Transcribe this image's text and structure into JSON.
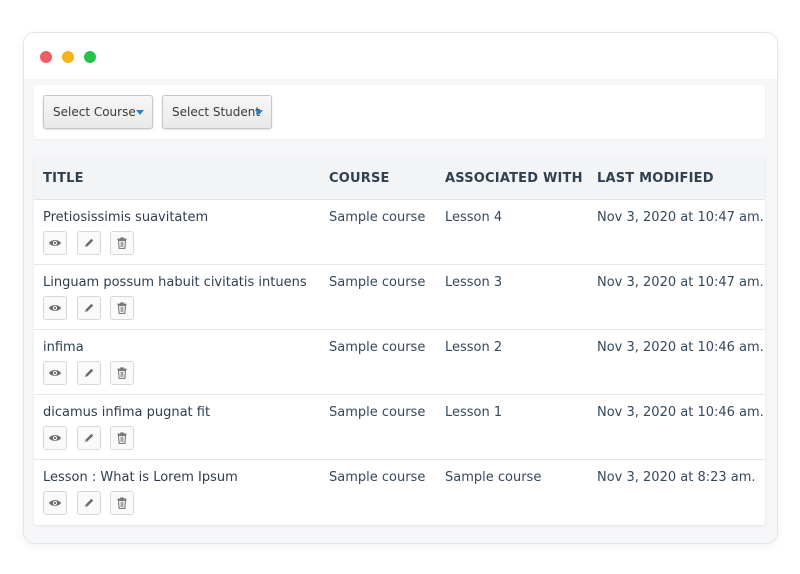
{
  "filters": {
    "course_label": "Select Course",
    "student_label": "Select Student"
  },
  "table": {
    "headers": [
      "TITLE",
      "COURSE",
      "ASSOCIATED WITH",
      "LAST MODIFIED"
    ],
    "rows": [
      {
        "title": "Pretiosissimis suavitatem",
        "course": "Sample course",
        "associated": "Lesson 4",
        "modified": "Nov 3, 2020 at 10:47 am."
      },
      {
        "title": "Linguam possum habuit civitatis intuens",
        "course": "Sample course",
        "associated": "Lesson 3",
        "modified": "Nov 3, 2020 at 10:47 am."
      },
      {
        "title": "infima",
        "course": "Sample course",
        "associated": "Lesson 2",
        "modified": "Nov 3, 2020 at 10:46 am."
      },
      {
        "title": "dicamus infima pugnat fit",
        "course": "Sample course",
        "associated": "Lesson 1",
        "modified": "Nov 3, 2020 at 10:46 am."
      },
      {
        "title": "Lesson : What is Lorem Ipsum",
        "course": "Sample course",
        "associated": "Sample course",
        "modified": "Nov 3, 2020 at 8:23 am."
      }
    ]
  },
  "icons": {
    "view": "eye-icon",
    "edit": "pencil-icon",
    "delete": "trash-icon"
  },
  "colors": {
    "dropdown_caret": "#1e88c7",
    "window_close": "#ee5f63",
    "window_minimize": "#f4b41a",
    "window_maximize": "#27c24a"
  }
}
